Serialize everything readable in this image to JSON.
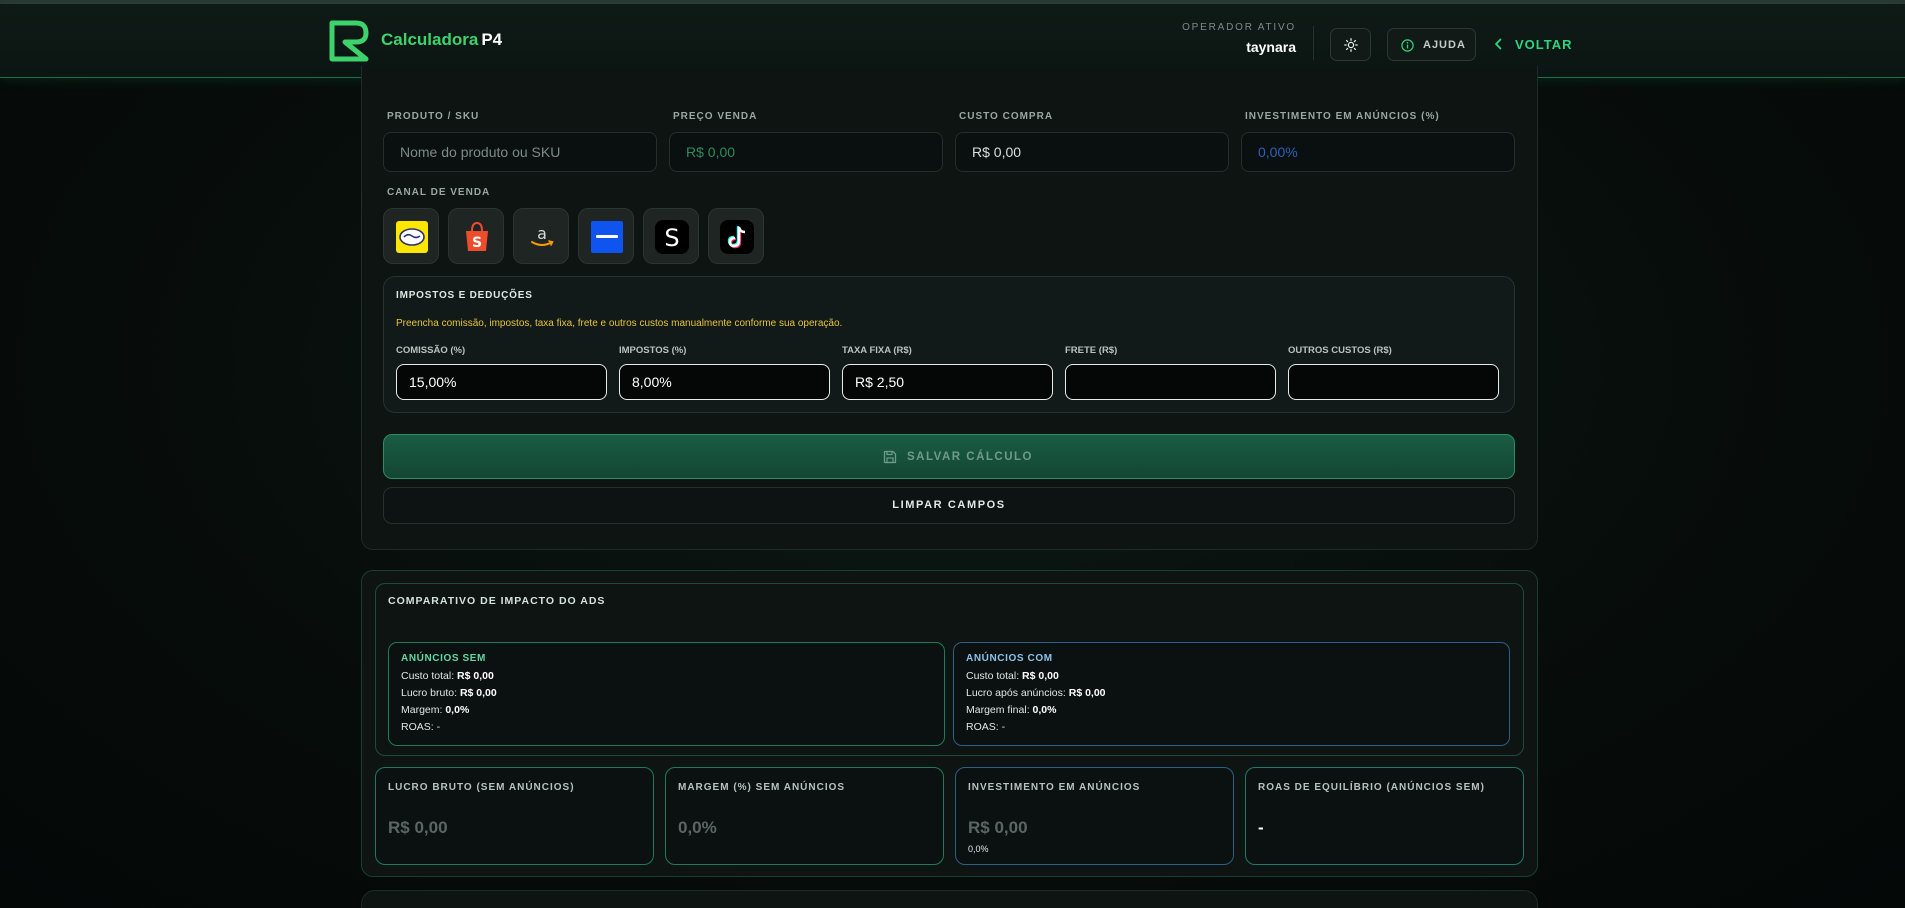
{
  "header": {
    "brand_main": "Calculadora",
    "brand_suffix": "P4",
    "operator_label": "OPERADOR ATIVO",
    "operator_name": "taynara",
    "help_label": "AJUDA",
    "back_label": "VOLTAR",
    "icons": [
      "logo-icon",
      "sun-icon",
      "info-icon",
      "chevron-left-icon"
    ]
  },
  "form": {
    "product_label": "PRODUTO / SKU",
    "product_placeholder": "Nome do produto ou SKU",
    "price_label": "PREÇO VENDA",
    "price_placeholder": "R$ 0,00",
    "cost_label": "CUSTO COMPRA",
    "cost_placeholder": "R$ 0,00",
    "ads_label": "INVESTIMENTO EM ANÚNCIOS (%)",
    "ads_placeholder": "0,00%",
    "channel_label": "CANAL DE VENDA",
    "channels": [
      "mercado-livre-icon",
      "shopee-icon",
      "amazon-icon",
      "magalu-icon",
      "shein-icon",
      "tiktok-icon"
    ]
  },
  "taxes": {
    "title": "IMPOSTOS E DEDUÇÕES",
    "note": "Preencha comissão, impostos, taxa fixa, frete e outros custos manualmente conforme sua operação.",
    "fields": [
      {
        "label": "COMISSÃO (%)",
        "value": "15,00%"
      },
      {
        "label": "IMPOSTOS (%)",
        "value": "8,00%"
      },
      {
        "label": "TAXA FIXA (R$)",
        "value": "R$ 2,50"
      },
      {
        "label": "FRETE (R$)",
        "value": ""
      },
      {
        "label": "OUTROS CUSTOS (R$)",
        "value": ""
      }
    ]
  },
  "actions": {
    "save_label": "SALVAR CÁLCULO",
    "clear_label": "LIMPAR CAMPOS"
  },
  "comparison": {
    "title": "COMPARATIVO DE IMPACTO DO ADS",
    "sem": {
      "title": "ANÚNCIOS SEM",
      "rows": [
        {
          "label": "Custo total: ",
          "value": "R$ 0,00"
        },
        {
          "label": "Lucro bruto: ",
          "value": "R$ 0,00"
        },
        {
          "label": "Margem: ",
          "value": "0,0%"
        },
        {
          "label": "ROAS: -",
          "value": ""
        }
      ]
    },
    "com": {
      "title": "ANÚNCIOS COM",
      "rows": [
        {
          "label": "Custo total: ",
          "value": "R$ 0,00"
        },
        {
          "label": "Lucro após anúncios: ",
          "value": "R$ 0,00"
        },
        {
          "label": "Margem final: ",
          "value": "0,0%"
        },
        {
          "label": "ROAS: -",
          "value": ""
        }
      ]
    }
  },
  "stats": [
    {
      "label": "LUCRO BRUTO (SEM ANÚNCIOS)",
      "value": "R$ 0,00",
      "sub": "",
      "color": "#1f7a58"
    },
    {
      "label": "MARGEM (%) SEM ANÚNCIOS",
      "value": "0,0%",
      "sub": "",
      "color": "#1f7a58"
    },
    {
      "label": "INVESTIMENTO EM ANÚNCIOS",
      "value": "R$ 0,00",
      "sub": "0,0%",
      "color": "#2f5e86"
    },
    {
      "label": "ROAS DE EQUILÍBRIO (ANÚNCIOS SEM)",
      "value": "-",
      "sub": "",
      "color": "#1f7a68"
    }
  ]
}
